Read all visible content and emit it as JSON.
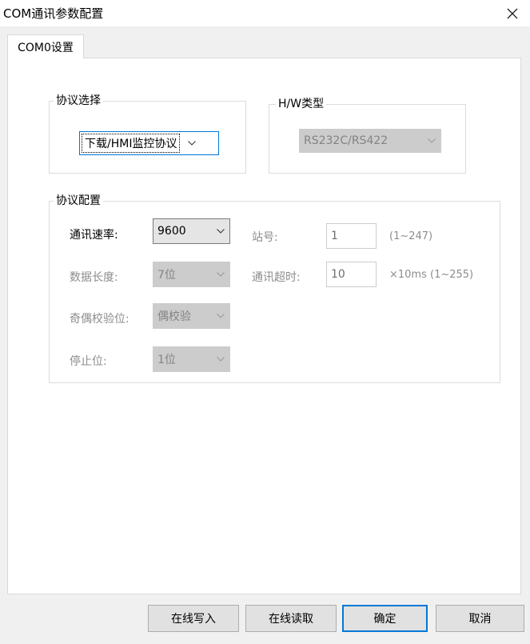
{
  "window": {
    "title": "COM通讯参数配置",
    "close_icon": "close-icon"
  },
  "tabs": [
    {
      "label": "COM0设置",
      "active": true
    }
  ],
  "protocol_select": {
    "legend": "协议选择",
    "value": "下载/HMI监控协议"
  },
  "hw_type": {
    "legend": "H/W类型",
    "value": "RS232C/RS422"
  },
  "protocol_config": {
    "legend": "协议配置",
    "baud_rate": {
      "label": "通讯速率:",
      "value": "9600"
    },
    "data_length": {
      "label": "数据长度:",
      "value": "7位"
    },
    "parity": {
      "label": "奇偶校验位:",
      "value": "偶校验"
    },
    "stop_bit": {
      "label": "停止位:",
      "value": "1位"
    },
    "station": {
      "label": "站号:",
      "value": "1",
      "hint": "(1~247)"
    },
    "timeout": {
      "label": "通讯超时:",
      "value": "10",
      "hint": "×10ms (1~255)"
    }
  },
  "buttons": {
    "online_write": "在线写入",
    "online_read": "在线读取",
    "ok": "确定",
    "cancel": "取消"
  },
  "colors": {
    "accent": "#0078d7",
    "disabled_text": "#8c8c8c"
  }
}
